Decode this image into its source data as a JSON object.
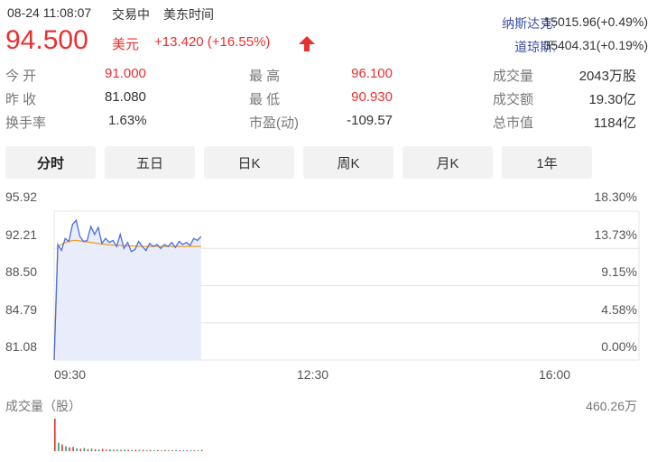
{
  "header": {
    "datetime": "08-24 11:08:07",
    "status": "交易中",
    "timezone": "美东时间",
    "price": "94.500",
    "currency": "美元",
    "change": "+13.420 (+16.55%)",
    "arrow_icon": "up-arrow-icon",
    "index1_name": "纳斯达克:",
    "index1_value": "15015.96(+0.49%)",
    "index2_name": "道琼斯:",
    "index2_value": "35404.31(+0.19%)"
  },
  "stats": {
    "open_label": "今 开",
    "open_value": "91.000",
    "prev_label": "昨 收",
    "prev_value": "81.080",
    "turnover_label": "换手率",
    "turnover_value": "1.63%",
    "high_label": "最 高",
    "high_value": "96.100",
    "low_label": "最 低",
    "low_value": "90.930",
    "pe_label": "市盈(动)",
    "pe_value": "-109.57",
    "volume_label": "成交量",
    "volume_value": "2043万股",
    "amount_label": "成交额",
    "amount_value": "19.30亿",
    "mcap_label": "总市值",
    "mcap_value": "1184亿"
  },
  "tabs": [
    "分时",
    "五日",
    "日K",
    "周K",
    "月K",
    "1年"
  ],
  "active_tab": 0,
  "colors": {
    "red": "#e93030",
    "blue_line": "#4a6fe0",
    "avg_line": "#f0a020",
    "fill": "#e8ecfb",
    "green": "#1aa37a"
  },
  "chart_data": {
    "type": "line",
    "y_price_ticks": [
      "95.92",
      "92.21",
      "88.50",
      "84.79",
      "81.08"
    ],
    "y_pct_ticks": [
      "18.30%",
      "13.73%",
      "9.15%",
      "4.58%",
      "0.00%"
    ],
    "x_ticks": [
      "09:30",
      "12:30",
      "16:00"
    ],
    "ylim": [
      81.08,
      95.92
    ],
    "series": [
      {
        "values": [
          81.08,
          92.6,
          92.0,
          93.2,
          92.9,
          94.6,
          95.0,
          93.4,
          92.9,
          93.0,
          94.4,
          93.6,
          94.3,
          92.7,
          93.2,
          92.8,
          93.0,
          92.4,
          93.6,
          92.2,
          92.8,
          91.9,
          92.1,
          92.9,
          92.4,
          92.0,
          92.7,
          92.4,
          92.6,
          92.2,
          92.6,
          92.4,
          92.8,
          92.3,
          92.9,
          92.6,
          92.8,
          92.5,
          93.2,
          93.0,
          93.4
        ]
      },
      {
        "values": [
          81.08,
          92.4,
          92.6,
          92.8,
          92.9,
          93.0,
          93.0,
          92.95,
          92.9,
          92.85,
          92.8,
          92.75,
          92.7,
          92.65,
          92.6,
          92.55,
          92.55,
          92.5,
          92.5,
          92.5,
          92.45,
          92.45,
          92.45,
          92.4,
          92.4,
          92.4,
          92.4,
          92.4,
          92.4,
          92.4,
          92.4,
          92.4,
          92.4,
          92.4,
          92.4,
          92.4,
          92.4,
          92.4,
          92.4,
          92.4,
          92.4
        ]
      }
    ],
    "volume_label": "成交量（股）",
    "volume_max": "460.26万",
    "volume": [
      460,
      120,
      95,
      70,
      55,
      60,
      40,
      35,
      45,
      30,
      38,
      28,
      25,
      32,
      22,
      26,
      20,
      24,
      18,
      22,
      19,
      17,
      21,
      16,
      18,
      15,
      17,
      14,
      16,
      13,
      15,
      14,
      12,
      16,
      13,
      14,
      12,
      15,
      13,
      14,
      18
    ],
    "volume_up": [
      true,
      false,
      true,
      false,
      true,
      true,
      false,
      true,
      false,
      true,
      false,
      true,
      false,
      true,
      true,
      false,
      true,
      false,
      true,
      false,
      true,
      false,
      true,
      false,
      true,
      false,
      true,
      false,
      true,
      false,
      true,
      false,
      true,
      false,
      true,
      false,
      true,
      false,
      true,
      false,
      true
    ]
  }
}
